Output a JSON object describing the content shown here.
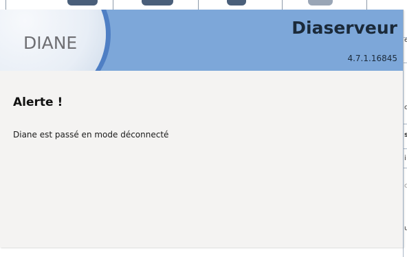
{
  "header": {
    "logo_text": "DIANE",
    "app_title": "Diaserveur",
    "version": "4.7.1.16845"
  },
  "alert": {
    "title": "Alerte !",
    "message": "Diane est passé en mode déconnecté"
  },
  "background": {
    "right_glyphs": [
      "e",
      "c",
      "s",
      "i",
      "c",
      "u"
    ]
  },
  "colors": {
    "header_bg": "#7da7d9",
    "logo_ring": "#4f7fc4",
    "dialog_bg": "#f4f3f2"
  }
}
